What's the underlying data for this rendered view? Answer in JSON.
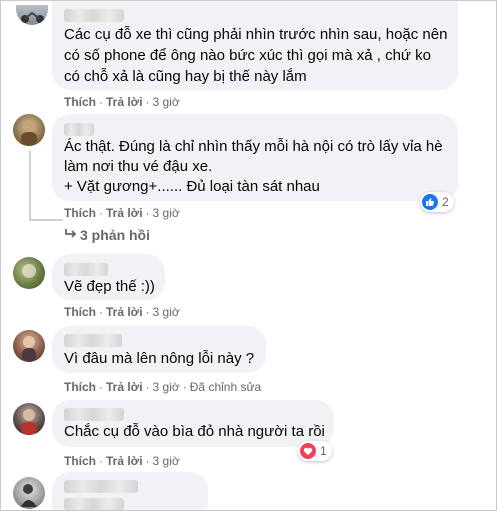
{
  "comments": [
    {
      "text_lines": [
        "Các cụ đỗ xe thì cũng phải nhìn trước nhìn sau, hoặc nên",
        "có số phone để ông nào bức xúc thì gọi mà xả , chứ ko",
        "có chỗ xả là cũng hay bị thế này lắm"
      ],
      "like": "Thích",
      "reply": "Trả lời",
      "time": "3 giờ"
    },
    {
      "text_lines": [
        "Ác thật. Đúng là chỉ nhìn thấy mỗi hà nội có trò lấy vỉa hè",
        "làm nơi thu vé đậu xe.",
        "+ Vặt gương+...... Đủ loại tàn sát nhau"
      ],
      "like": "Thích",
      "reply": "Trả lời",
      "time": "3 giờ",
      "reaction": {
        "icon": "like-reaction-icon",
        "count": "2",
        "color": "#1877f2"
      },
      "replies_label": "3 phản hồi"
    },
    {
      "text_lines": [
        "Vẽ đẹp thế :))"
      ],
      "like": "Thích",
      "reply": "Trả lời",
      "time": "3 giờ"
    },
    {
      "text_lines": [
        "Vì đâu mà lên nông lỗi này ?"
      ],
      "like": "Thích",
      "reply": "Trả lời",
      "time": "3 giờ",
      "edited": "Đã chỉnh sửa"
    },
    {
      "text_lines": [
        "Chắc cụ đỗ vào bìa đỏ nhà người ta rồi"
      ],
      "like": "Thích",
      "reply": "Trả lời",
      "time": "3 giờ",
      "reaction": {
        "icon": "haha-reaction-icon",
        "count": "1",
        "color": "#f33e58"
      }
    }
  ],
  "colors": {
    "bubble": "#f0f2f5",
    "meta": "#65676b",
    "text": "#050505"
  }
}
